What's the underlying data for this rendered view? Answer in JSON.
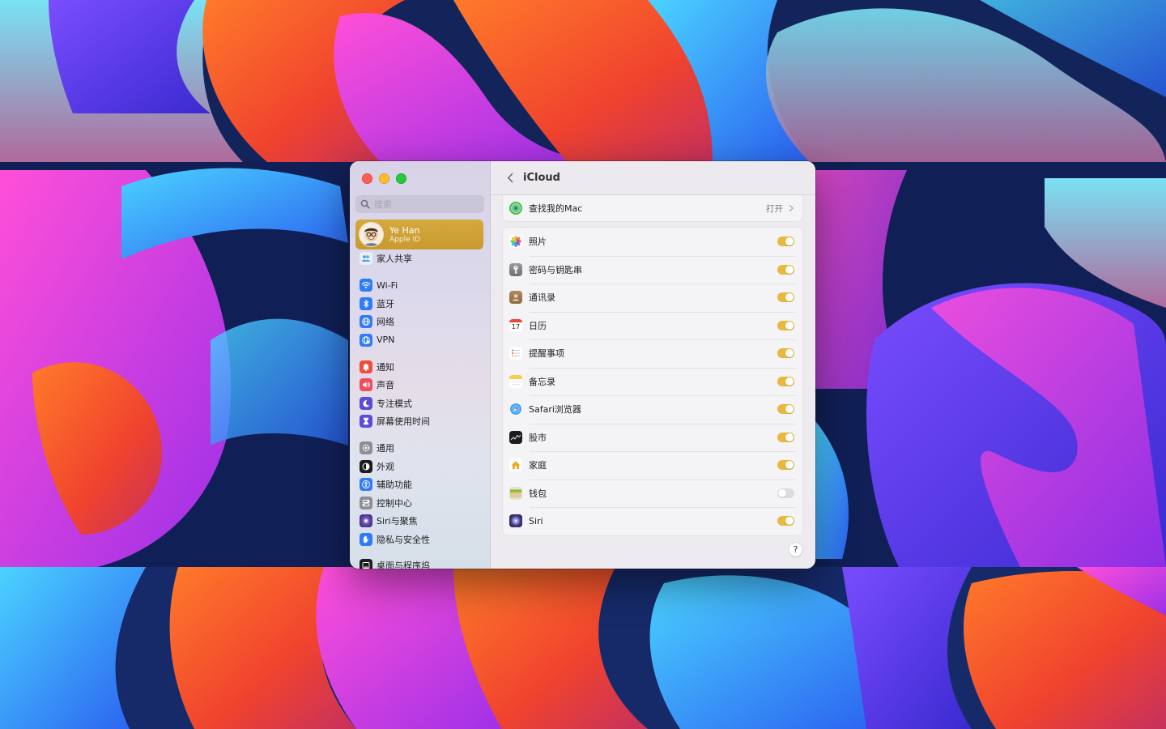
{
  "window": {
    "title": "iCloud"
  },
  "sidebar": {
    "search_placeholder": "搜索",
    "account": {
      "name": "Ye Han",
      "subtitle": "Apple ID"
    },
    "items": [
      {
        "label": "家人共享",
        "icon": "family-icon",
        "color": "#e9eef7"
      },
      {
        "label": "Wi-Fi",
        "icon": "wifi-icon",
        "color": "#2f7cf6"
      },
      {
        "label": "蓝牙",
        "icon": "bluetooth-icon",
        "color": "#2f7cf6"
      },
      {
        "label": "网络",
        "icon": "network-icon",
        "color": "#2f7cf6"
      },
      {
        "label": "VPN",
        "icon": "vpn-icon",
        "color": "#2f7cf6"
      },
      {
        "label": "通知",
        "icon": "notifications-icon",
        "color": "#f04c3e"
      },
      {
        "label": "声音",
        "icon": "sound-icon",
        "color": "#f04c5e"
      },
      {
        "label": "专注模式",
        "icon": "focus-icon",
        "color": "#5b4bd6"
      },
      {
        "label": "屏幕使用时间",
        "icon": "screen-time-icon",
        "color": "#5b4bd6"
      },
      {
        "label": "通用",
        "icon": "general-icon",
        "color": "#8e8e93"
      },
      {
        "label": "外观",
        "icon": "appearance-icon",
        "color": "#1c1c1e"
      },
      {
        "label": "辅助功能",
        "icon": "accessibility-icon",
        "color": "#2f7cf6"
      },
      {
        "label": "控制中心",
        "icon": "control-center-icon",
        "color": "#8e8e93"
      },
      {
        "label": "Siri与聚焦",
        "icon": "siri-icon",
        "color": "#3a3a8c"
      },
      {
        "label": "隐私与安全性",
        "icon": "privacy-icon",
        "color": "#2f7cf6"
      },
      {
        "label": "桌面与程序坞",
        "icon": "desktop-dock-icon",
        "color": "#1c1c1e"
      }
    ]
  },
  "main": {
    "find_my": {
      "label": "查找我的Mac",
      "value": "打开",
      "icon": "find-my-icon"
    },
    "apps": [
      {
        "label": "照片",
        "icon": "photos-icon",
        "on": true
      },
      {
        "label": "密码与钥匙串",
        "icon": "keychain-icon",
        "on": true
      },
      {
        "label": "通讯录",
        "icon": "contacts-icon",
        "on": true
      },
      {
        "label": "日历",
        "icon": "calendar-icon",
        "on": true,
        "badge": "17"
      },
      {
        "label": "提醒事项",
        "icon": "reminders-icon",
        "on": true
      },
      {
        "label": "备忘录",
        "icon": "notes-icon",
        "on": true
      },
      {
        "label": "Safari浏览器",
        "icon": "safari-icon",
        "on": true
      },
      {
        "label": "股市",
        "icon": "stocks-icon",
        "on": true
      },
      {
        "label": "家庭",
        "icon": "home-icon",
        "on": true
      },
      {
        "label": "钱包",
        "icon": "wallet-icon",
        "on": false
      },
      {
        "label": "Siri",
        "icon": "siri-icon",
        "on": true
      }
    ],
    "help_label": "?"
  },
  "colors": {
    "accent": "#e8b93e",
    "selection": "#cfa23a"
  }
}
